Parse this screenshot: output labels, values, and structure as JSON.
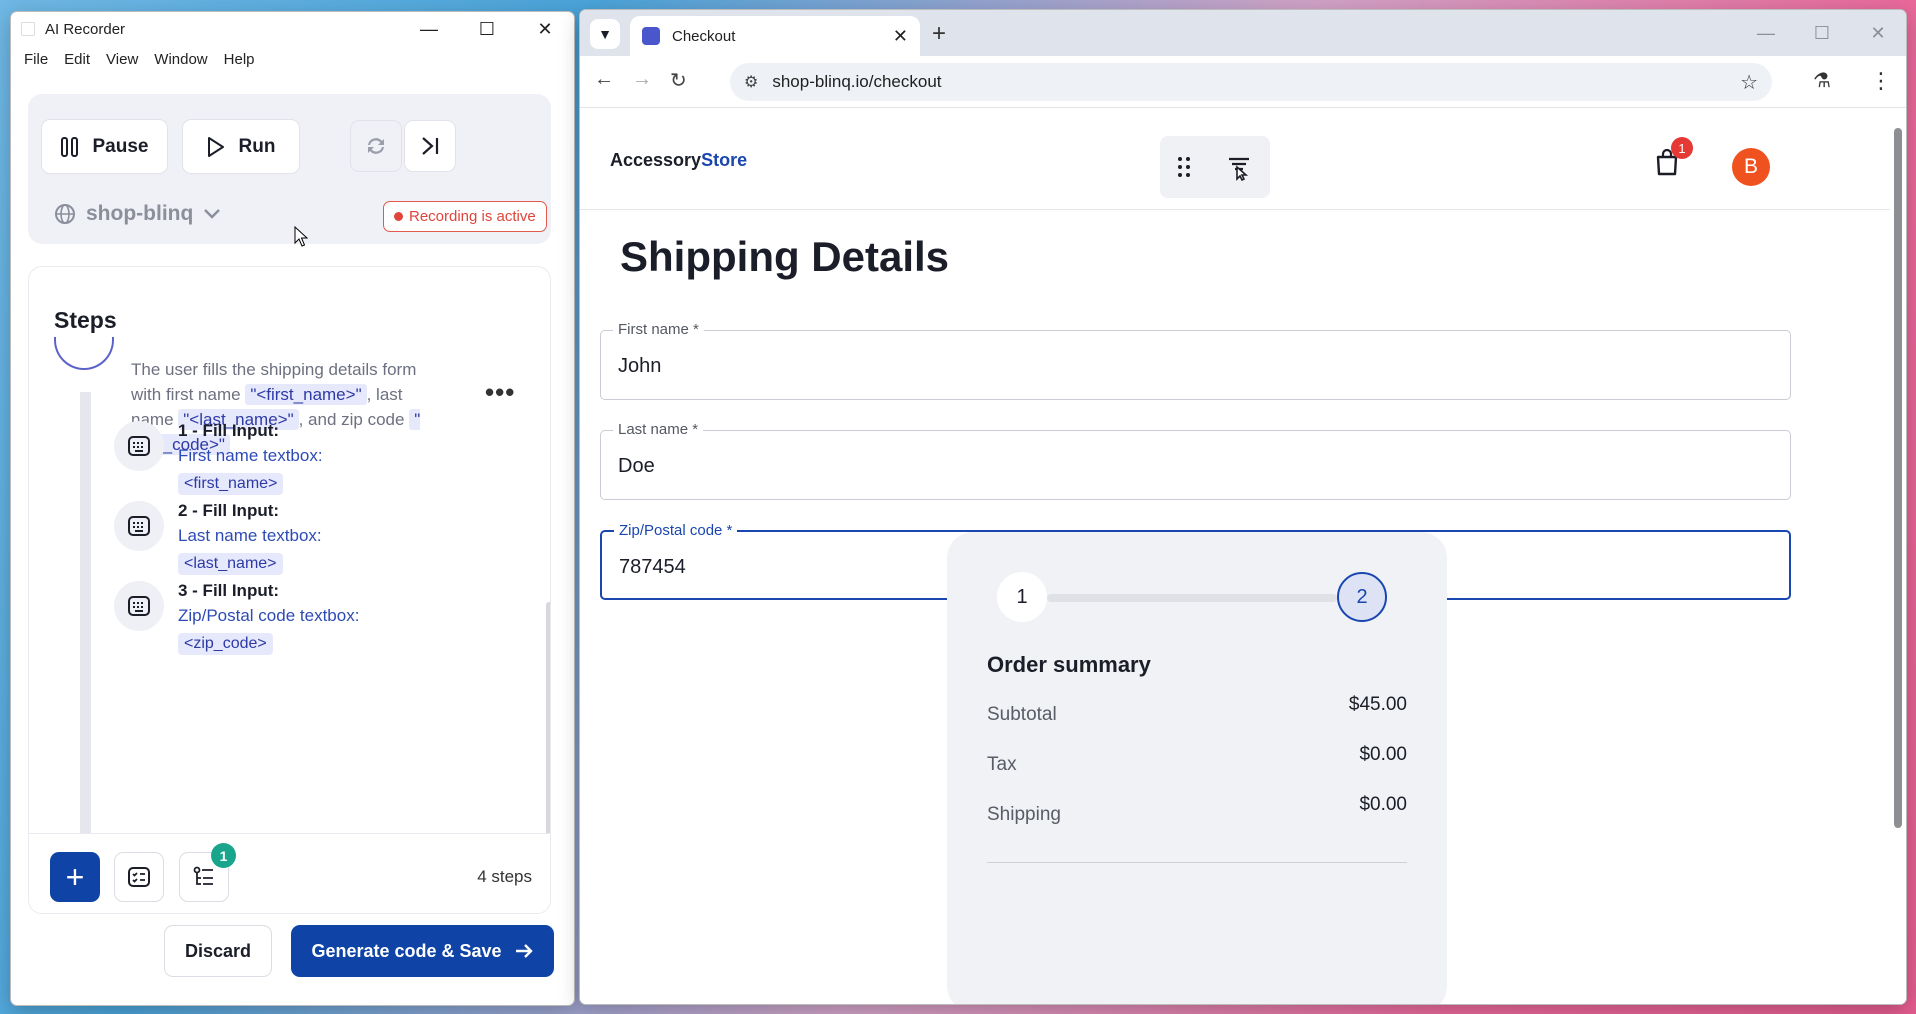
{
  "recorder": {
    "title": "AI Recorder",
    "menu": [
      "File",
      "Edit",
      "View",
      "Window",
      "Help"
    ],
    "pause_label": "Pause",
    "run_label": "Run",
    "project": "shop-blinq",
    "recording_status": "Recording is active",
    "steps_title": "Steps",
    "step": {
      "desc_pre": "The user fills the shipping details form with first name ",
      "var_first": "\"<first_name>\"",
      "desc_mid1": ", last name ",
      "var_last": "\"<last_name>\"",
      "desc_mid2": ", and zip code ",
      "var_zip": "\"<zip_code>\"",
      "sub": [
        {
          "title": "1 - Fill Input:",
          "target": "First name textbox:",
          "value": "<first_name>"
        },
        {
          "title": "2 - Fill Input:",
          "target": "Last name textbox:",
          "value": "<last_name>"
        },
        {
          "title": "3 - Fill Input:",
          "target": "Zip/Postal code textbox:",
          "value": "<zip_code>"
        }
      ]
    },
    "badge_count": "1",
    "steps_count": "4 steps",
    "discard_label": "Discard",
    "generate_label": "Generate code & Save"
  },
  "browser": {
    "tab_title": "Checkout",
    "url": "shop-blinq.io/checkout"
  },
  "site": {
    "logo_a": "Accessory",
    "logo_b": "Store",
    "cart_count": "1",
    "avatar": "B",
    "heading": "Shipping Details",
    "fields": [
      {
        "label": "First name *",
        "value": "John"
      },
      {
        "label": "Last name *",
        "value": "Doe"
      },
      {
        "label": "Zip/Postal code *",
        "value": "787454"
      }
    ],
    "steps": [
      "1",
      "2"
    ],
    "summary_title": "Order summary",
    "rows": [
      {
        "label": "Subtotal",
        "value": "$45.00"
      },
      {
        "label": "Tax",
        "value": "$0.00"
      },
      {
        "label": "Shipping",
        "value": "$0.00"
      }
    ]
  },
  "colors": {
    "primary": "#0f44a6",
    "recording": "#e0443a",
    "badge": "#19a58c",
    "avatar": "#f0521f"
  }
}
